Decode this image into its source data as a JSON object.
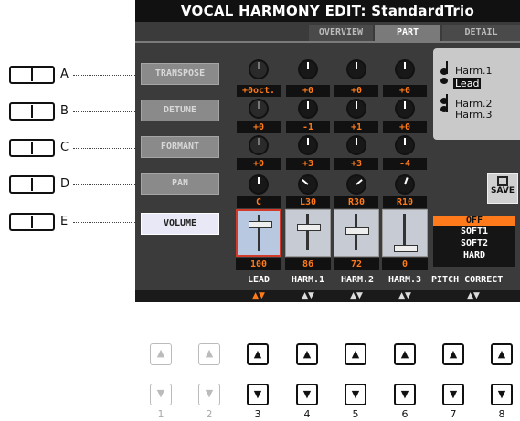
{
  "screen": {
    "title": "VOCAL HARMONY EDIT: StandardTrio",
    "tabs": [
      {
        "label": "OVERVIEW",
        "active": false
      },
      {
        "label": "PART",
        "active": true
      },
      {
        "label": "DETAIL",
        "active": false
      }
    ],
    "params": [
      {
        "label": "TRANSPOSE",
        "active": false
      },
      {
        "label": "DETUNE",
        "active": false
      },
      {
        "label": "FORMANT",
        "active": false
      },
      {
        "label": "PAN",
        "active": false
      },
      {
        "label": "VOLUME",
        "active": true
      }
    ],
    "values": {
      "transpose": [
        "+0oct.",
        "+0",
        "+0",
        "+0"
      ],
      "detune": [
        "+0",
        "-1",
        "+1",
        "+0"
      ],
      "formant": [
        "+0",
        "+3",
        "+3",
        "-4"
      ],
      "pan": [
        "C",
        "L30",
        "R30",
        "R10"
      ],
      "volume": [
        "100",
        "86",
        "72",
        "0"
      ]
    },
    "volume_levels": [
      100,
      86,
      72,
      0
    ],
    "parts": [
      "LEAD",
      "HARM.1",
      "HARM.2",
      "HARM.3",
      "PITCH CORRECT"
    ],
    "pitch_correct_options": [
      "OFF",
      "SOFT1",
      "SOFT2",
      "HARD"
    ],
    "pitch_correct_selected": "OFF",
    "score_labels": [
      "Harm.1",
      "Lead",
      "Harm.2",
      "Harm.3"
    ],
    "save_label": "SAVE",
    "arrows": "▲▼"
  },
  "side_buttons": [
    "A",
    "B",
    "C",
    "D",
    "E"
  ],
  "bottom_buttons": {
    "numbers": [
      "1",
      "2",
      "3",
      "4",
      "5",
      "6",
      "7",
      "8"
    ],
    "up": "▲",
    "down": "▼"
  },
  "colors": {
    "screen_bg": "#3b3b3b",
    "value_text": "#ff7a1a",
    "selected_border": "#d23a2a",
    "pitch_selected_bg": "#ff7a1a"
  }
}
